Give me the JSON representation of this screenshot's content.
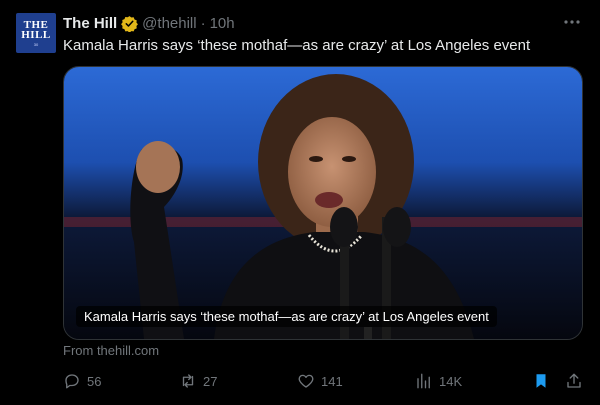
{
  "author": {
    "name": "The Hill",
    "handle": "@thehill",
    "separator": "·",
    "time": "10h",
    "avatar_line1": "THE",
    "avatar_line2": "HILL",
    "avatar_line3": "30"
  },
  "tweet": {
    "text": "Kamala Harris says ‘these mothaf—as are crazy’ at Los Angeles event"
  },
  "card": {
    "caption": "Kamala Harris says ‘these mothaf—as are crazy’ at Los Angeles event",
    "source": "From thehill.com"
  },
  "actions": {
    "replies": "56",
    "retweets": "27",
    "likes": "141",
    "views": "14K"
  },
  "colors": {
    "background": "#000000",
    "text": "#e7e9ea",
    "muted": "#71767b",
    "verified": "#e2b719",
    "bookmark": "#1d9bf0"
  },
  "icons": {
    "verified": "verified-badge-icon",
    "more": "more-horizontal-icon",
    "reply": "reply-icon",
    "retweet": "retweet-icon",
    "like": "heart-icon",
    "views": "views-chart-icon",
    "bookmark": "bookmark-icon",
    "share": "share-icon"
  }
}
